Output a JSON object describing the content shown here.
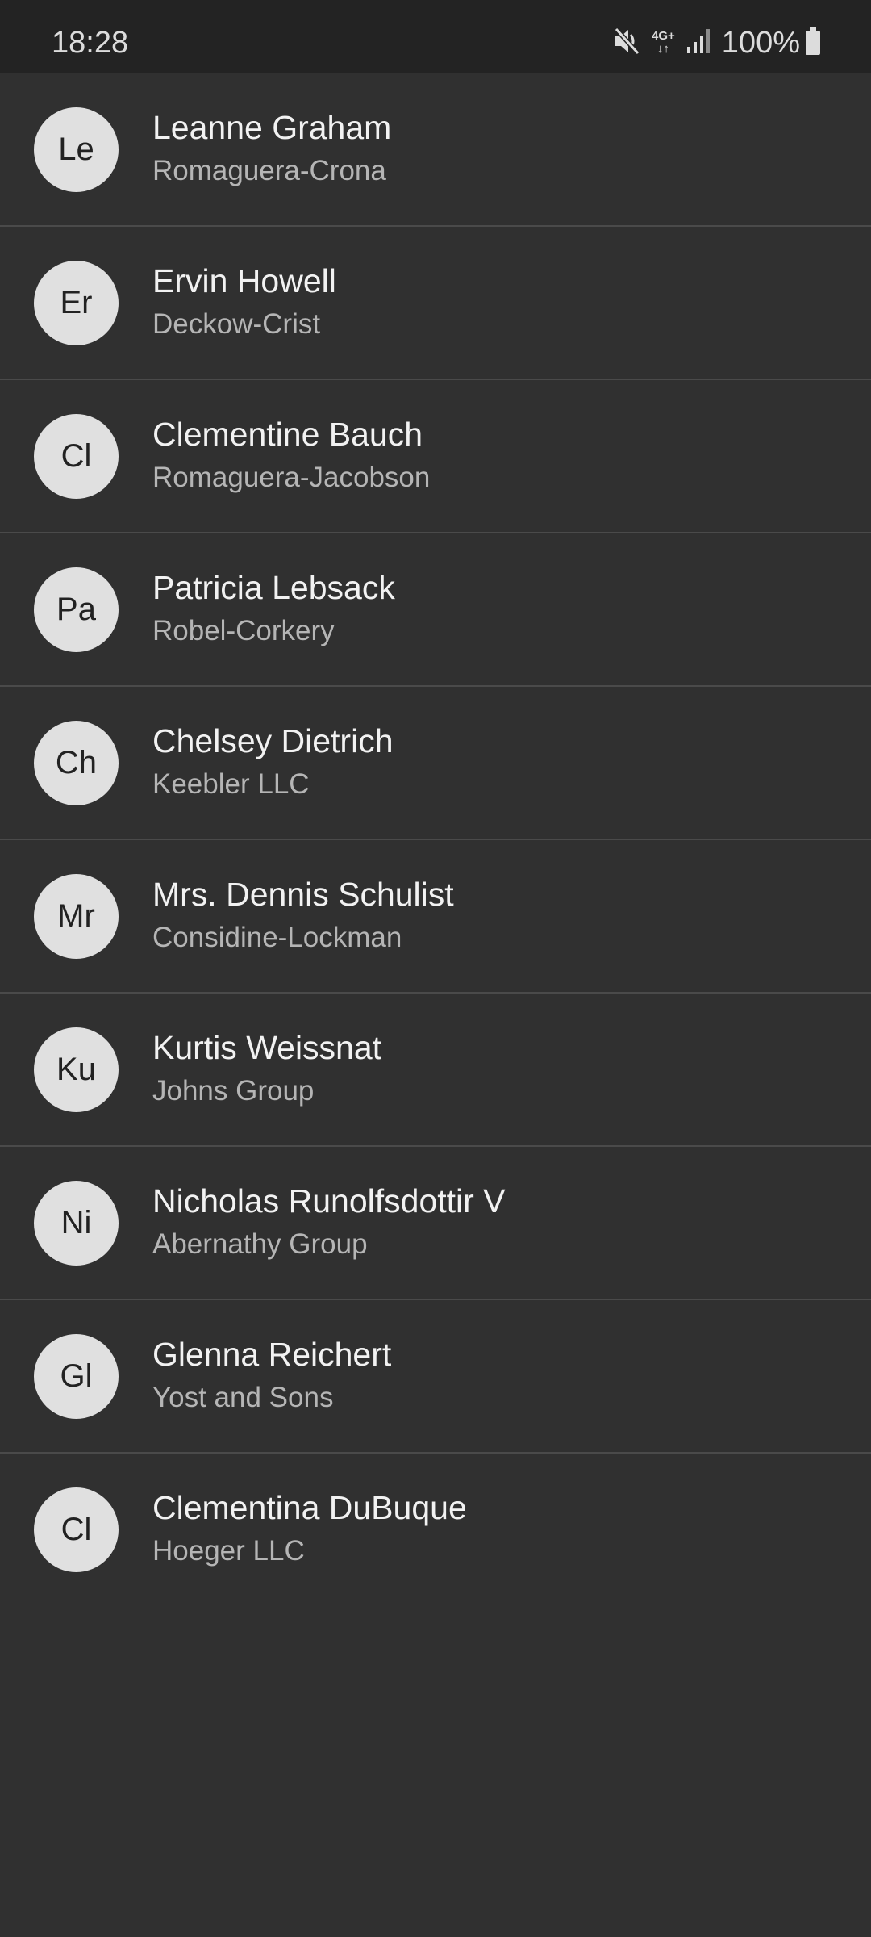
{
  "status_bar": {
    "time": "18:28",
    "network_label_top": "4G+",
    "network_label_bottom": "↓↑",
    "battery_percent": "100%",
    "icons": [
      "mute-icon",
      "network-4g-icon",
      "signal-icon",
      "battery-icon"
    ]
  },
  "contacts": [
    {
      "initials": "Le",
      "name": "Leanne Graham",
      "company": "Romaguera-Crona"
    },
    {
      "initials": "Er",
      "name": "Ervin Howell",
      "company": "Deckow-Crist"
    },
    {
      "initials": "Cl",
      "name": "Clementine Bauch",
      "company": "Romaguera-Jacobson"
    },
    {
      "initials": "Pa",
      "name": "Patricia Lebsack",
      "company": "Robel-Corkery"
    },
    {
      "initials": "Ch",
      "name": "Chelsey Dietrich",
      "company": "Keebler LLC"
    },
    {
      "initials": "Mr",
      "name": "Mrs. Dennis Schulist",
      "company": "Considine-Lockman"
    },
    {
      "initials": "Ku",
      "name": "Kurtis Weissnat",
      "company": "Johns Group"
    },
    {
      "initials": "Ni",
      "name": "Nicholas Runolfsdottir V",
      "company": "Abernathy Group"
    },
    {
      "initials": "Gl",
      "name": "Glenna Reichert",
      "company": "Yost and Sons"
    },
    {
      "initials": "Cl",
      "name": "Clementina DuBuque",
      "company": "Hoeger LLC"
    }
  ],
  "colors": {
    "background": "#303030",
    "status_bar": "#232323",
    "avatar": "#e0e0e0",
    "divider": "#4a4a4a"
  }
}
